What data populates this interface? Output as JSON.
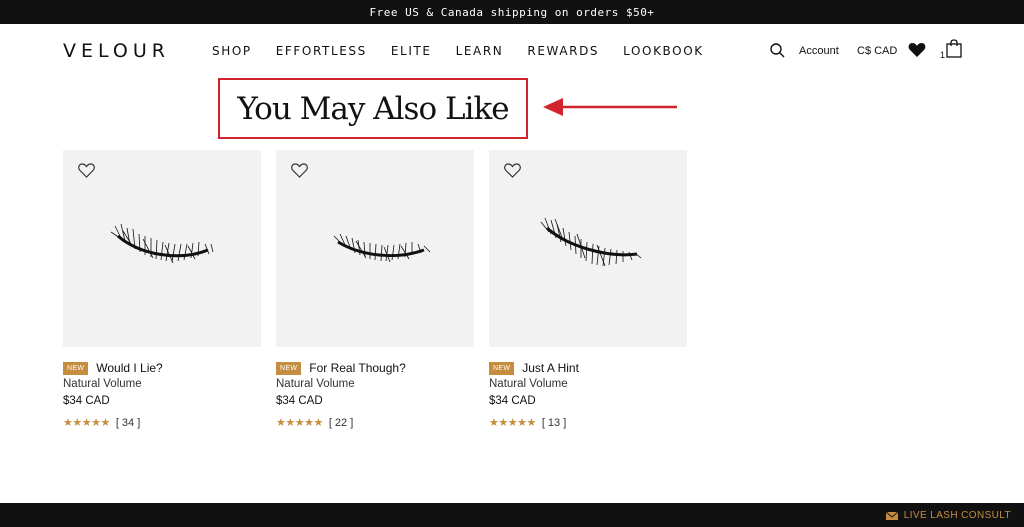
{
  "promo": {
    "text": "Free US & Canada shipping on orders $50+"
  },
  "header": {
    "logo": "VELOUR",
    "nav": [
      "SHOP",
      "EFFORTLESS",
      "ELITE",
      "LEARN",
      "REWARDS",
      "LOOKBOOK"
    ],
    "account_label": "Account",
    "currency": "C$ CAD",
    "cart_count": "1"
  },
  "section": {
    "title": "You May Also Like"
  },
  "products": [
    {
      "badge": "NEW",
      "name": "Would I Lie?",
      "type": "Natural Volume",
      "price": "$34 CAD",
      "stars": "★★★★★",
      "reviews": "[ 34 ]"
    },
    {
      "badge": "NEW",
      "name": "For Real Though?",
      "type": "Natural Volume",
      "price": "$34 CAD",
      "stars": "★★★★★",
      "reviews": "[ 22 ]"
    },
    {
      "badge": "NEW",
      "name": "Just A Hint",
      "type": "Natural Volume",
      "price": "$34 CAD",
      "stars": "★★★★★",
      "reviews": "[ 13 ]"
    }
  ],
  "footer": {
    "consult_label": "LIVE LASH CONSULT"
  },
  "colors": {
    "accent": "#c58d3f",
    "highlight": "#d0232b",
    "bar": "#111111"
  },
  "icons": [
    "search-icon",
    "heart-icon",
    "bag-icon",
    "wishlist-heart-icon",
    "chat-icon",
    "arrow-icon"
  ]
}
